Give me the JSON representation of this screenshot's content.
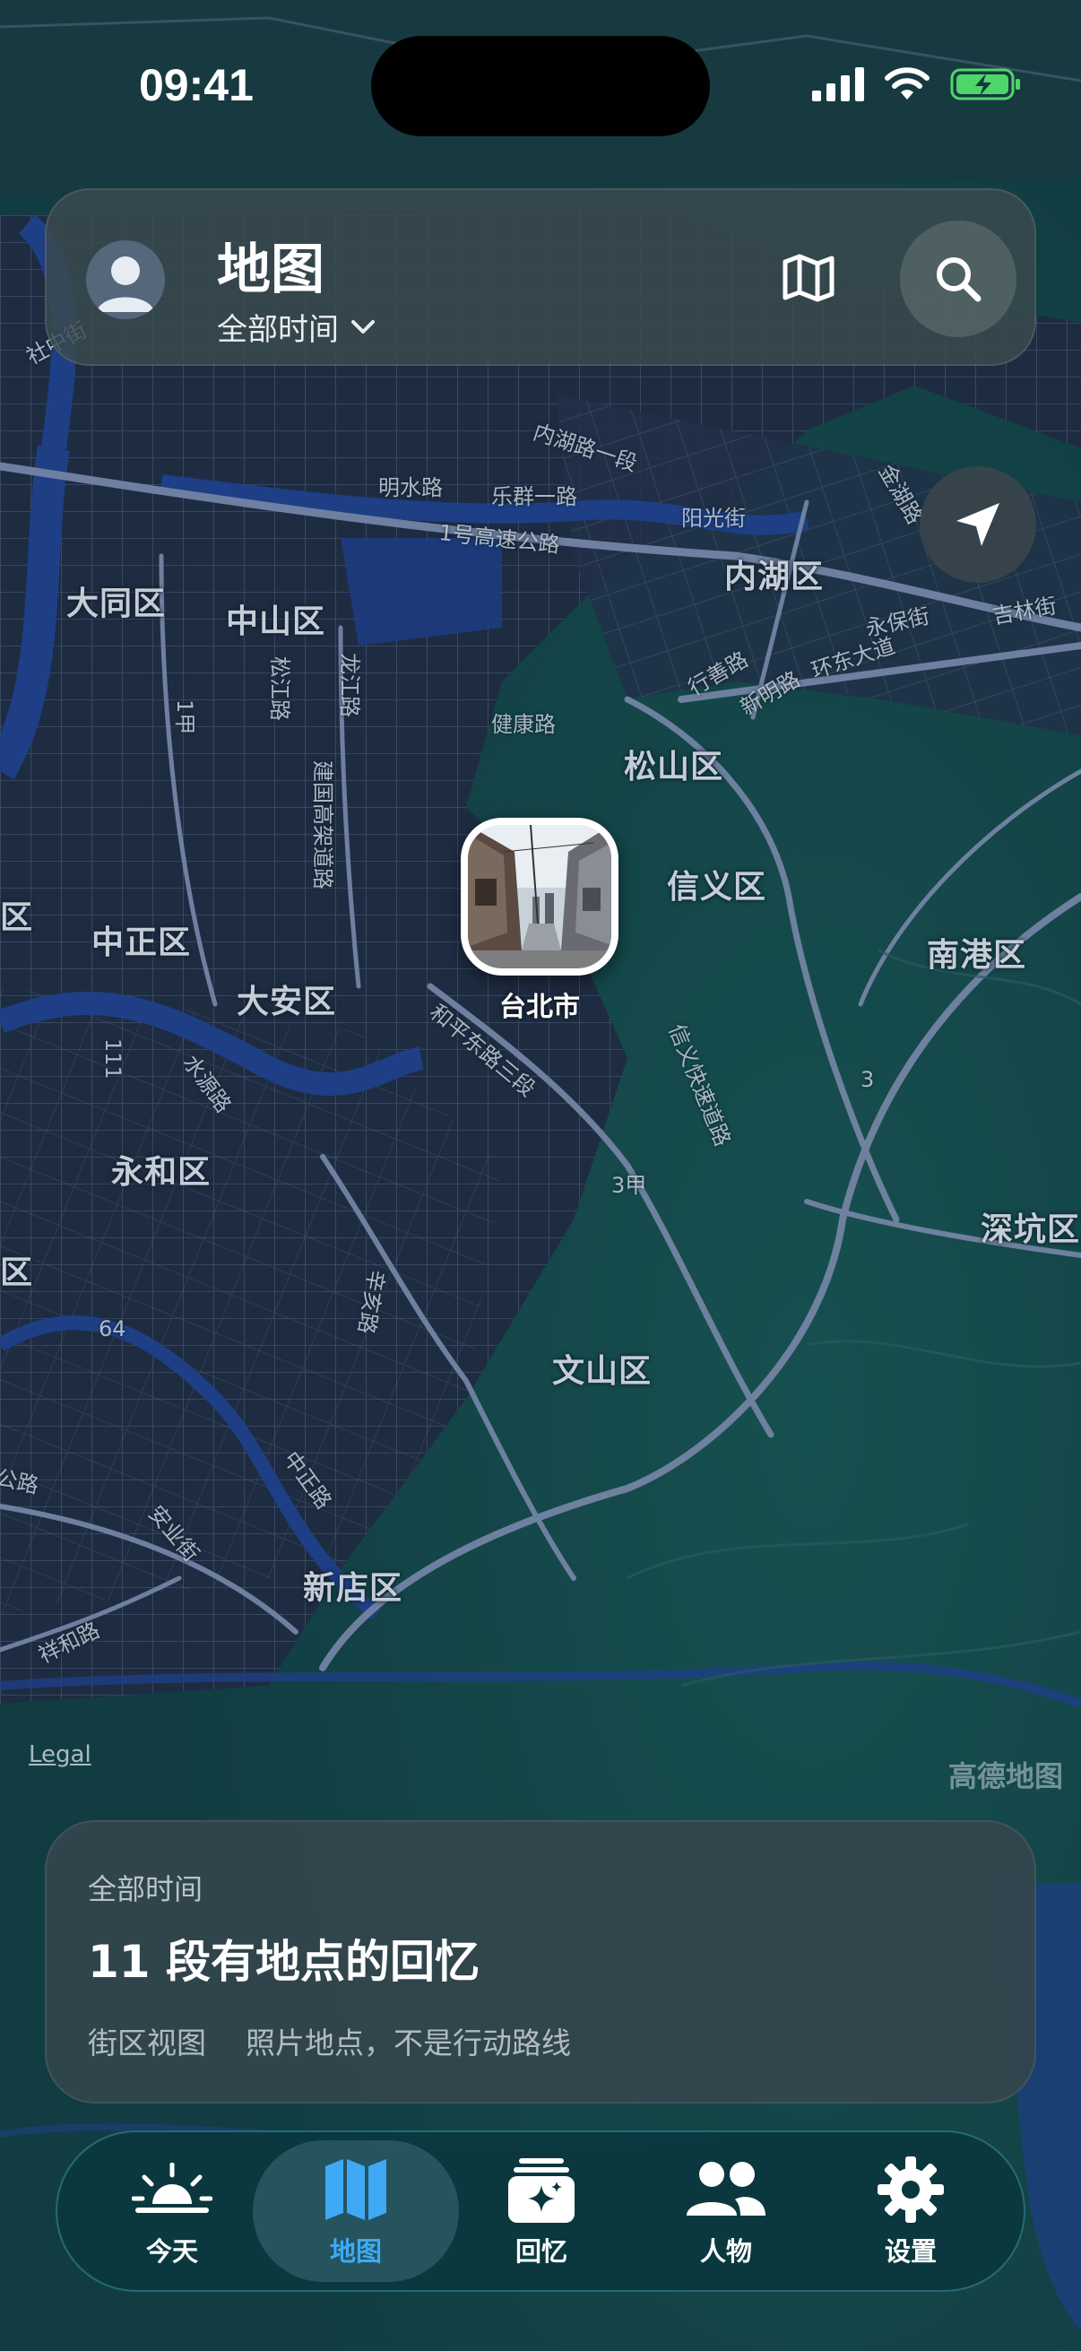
{
  "status_bar": {
    "time": "09:41"
  },
  "header": {
    "title": "地图",
    "time_filter": "全部时间"
  },
  "map": {
    "districts": [
      "大同区",
      "中山区",
      "内湖区",
      "松山区",
      "信义区",
      "中正区",
      "大安区",
      "南港区",
      "永和区",
      "文山区",
      "新店区",
      "深坑区",
      "区",
      "区"
    ],
    "roads": [
      "内湖路一段",
      "明水路",
      "乐群一路",
      "1号高速公路",
      "阳光街",
      "永保街",
      "吉林街",
      "行善路",
      "新明路",
      "环东大道",
      "龙江路",
      "松江路",
      "1甲",
      "健康路",
      "建国高架道路",
      "和平东路三段",
      "信义快速道路",
      "水源路",
      "3甲",
      "3",
      "64",
      "辛亥路",
      "中正路",
      "安业街",
      "公路",
      "祥和路",
      "金湖路",
      "社中街",
      "111"
    ],
    "pin_label": "台北市",
    "legal": "Legal",
    "provider": "高德地图"
  },
  "summary": {
    "time_filter": "全部时间",
    "title": "11 段有地点的回忆",
    "view_mode": "街区视图",
    "note": "照片地点，不是行动路线"
  },
  "tabs": [
    {
      "label": "今天",
      "icon": "sunrise-icon"
    },
    {
      "label": "地图",
      "icon": "map-icon",
      "active": true
    },
    {
      "label": "回忆",
      "icon": "memories-icon"
    },
    {
      "label": "人物",
      "icon": "people-icon"
    },
    {
      "label": "设置",
      "icon": "gear-icon"
    }
  ],
  "colors": {
    "accent": "#3fa9f5",
    "map_land": "#143d42",
    "map_urban": "#1f2d44",
    "map_water": "#1e3f86"
  }
}
